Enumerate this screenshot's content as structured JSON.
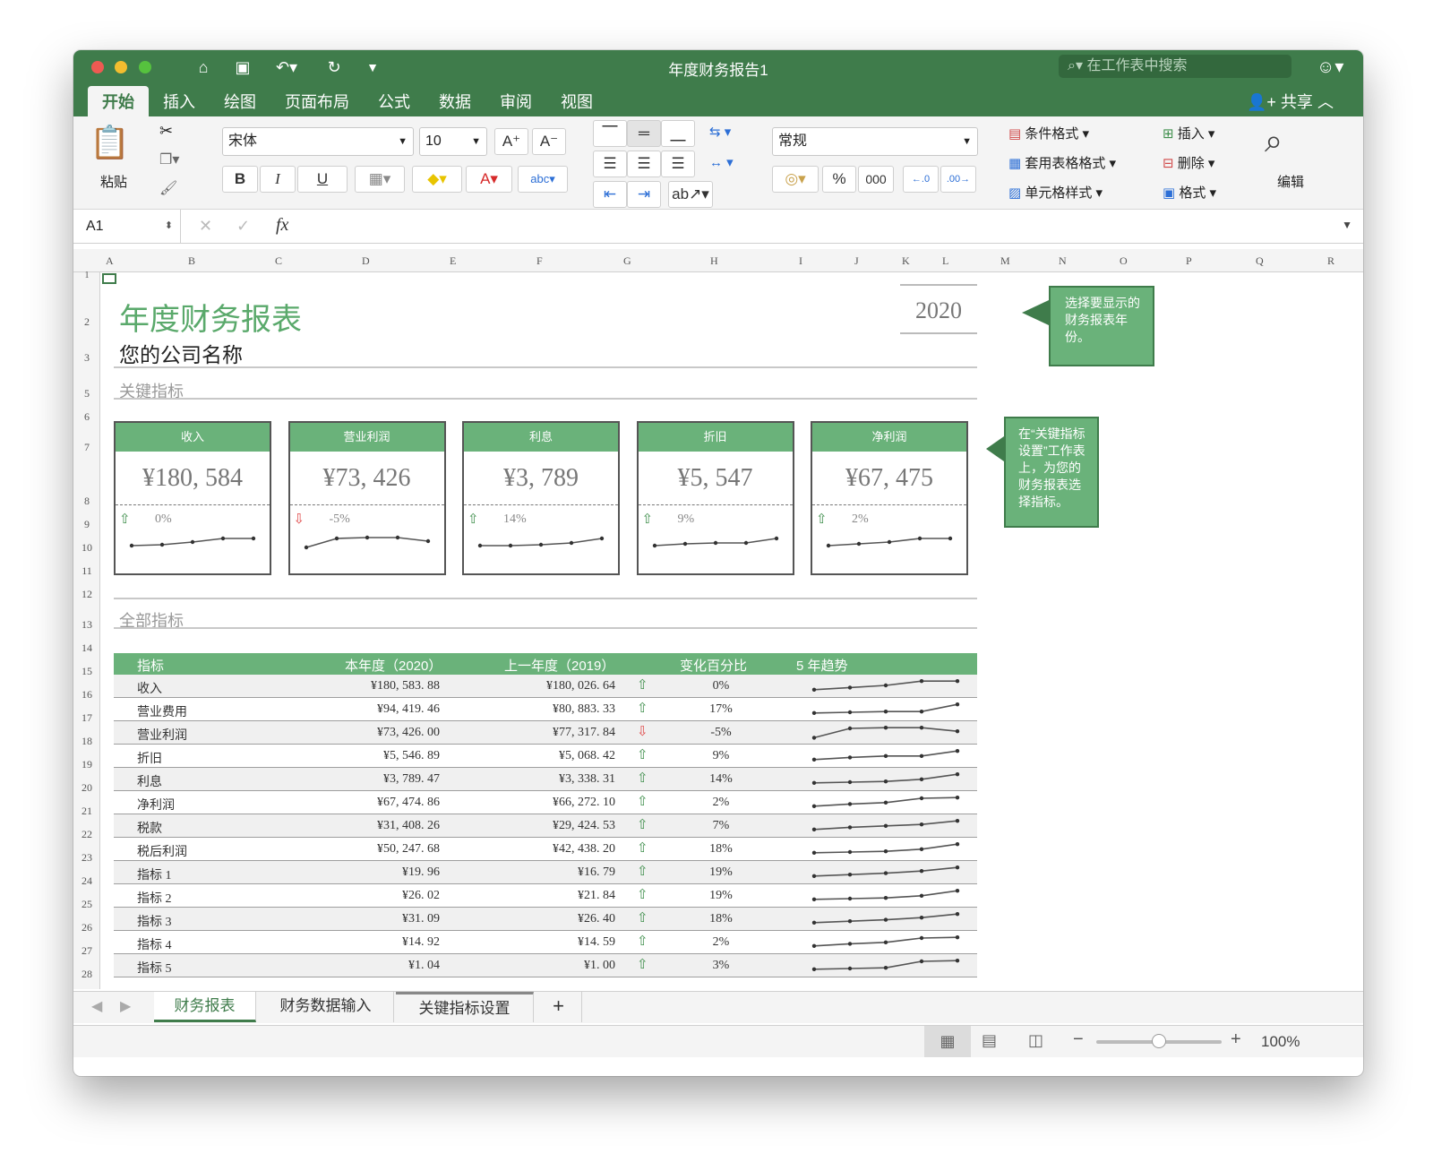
{
  "window": {
    "title": "年度财务报告1",
    "search_placeholder": "在工作表中搜索",
    "share": "共享",
    "tabs": [
      "开始",
      "插入",
      "绘图",
      "页面布局",
      "公式",
      "数据",
      "审阅",
      "视图"
    ],
    "active_tab": 0
  },
  "ribbon": {
    "paste": "粘贴",
    "font_name": "宋体",
    "font_size": "10",
    "number_format": "常规",
    "conditional_format": "条件格式",
    "table_format": "套用表格格式",
    "cell_styles": "单元格样式",
    "insert": "插入",
    "delete": "删除",
    "format": "格式",
    "edit": "编辑",
    "bold": "B",
    "italic": "I",
    "underline": "U",
    "percent": "%",
    "thousands": "000"
  },
  "formula_bar": {
    "cell_ref": "A1",
    "fx": "fx",
    "content": ""
  },
  "columns": [
    "A",
    "B",
    "C",
    "D",
    "E",
    "F",
    "G",
    "H",
    "I",
    "J",
    "K",
    "L",
    "M",
    "N",
    "O",
    "P",
    "Q",
    "R"
  ],
  "rows": [
    "1",
    "2",
    "3",
    "5",
    "6",
    "7",
    "8",
    "9",
    "10",
    "11",
    "12",
    "13",
    "14",
    "15",
    "16",
    "17",
    "18",
    "19",
    "20",
    "21",
    "22",
    "23",
    "24",
    "25",
    "26",
    "27",
    "28"
  ],
  "report": {
    "title": "年度财务报表",
    "company": "您的公司名称",
    "year": "2020",
    "key_metrics_heading": "关键指标",
    "all_metrics_heading": "全部指标",
    "callout_year": "选择要显示的财务报表年份。",
    "callout_metrics": "在“关键指标设置”工作表上，为您的财务报表选择指标。"
  },
  "kpis": [
    {
      "label": "收入",
      "value": "¥180, 584",
      "change": "0%",
      "direction": "up",
      "trend": [
        0.3,
        0.35,
        0.5,
        0.7,
        0.7
      ]
    },
    {
      "label": "营业利润",
      "value": "¥73, 426",
      "change": "-5%",
      "direction": "down",
      "trend": [
        0.2,
        0.7,
        0.75,
        0.75,
        0.55
      ]
    },
    {
      "label": "利息",
      "value": "¥3, 789",
      "change": "14%",
      "direction": "up",
      "trend": [
        0.3,
        0.3,
        0.35,
        0.45,
        0.7
      ]
    },
    {
      "label": "折旧",
      "value": "¥5, 547",
      "change": "9%",
      "direction": "up",
      "trend": [
        0.3,
        0.4,
        0.45,
        0.45,
        0.7
      ]
    },
    {
      "label": "净利润",
      "value": "¥67, 475",
      "change": "2%",
      "direction": "up",
      "trend": [
        0.3,
        0.4,
        0.5,
        0.7,
        0.7
      ]
    }
  ],
  "table": {
    "headers": [
      "指标",
      "本年度（2020）",
      "上一年度（2019）",
      "变化百分比",
      "5 年趋势"
    ],
    "rows": [
      {
        "name": "收入",
        "current": "¥180, 583. 88",
        "previous": "¥180, 026. 64",
        "direction": "up",
        "pct": "0%",
        "trend": [
          0.2,
          0.35,
          0.5,
          0.8,
          0.8
        ]
      },
      {
        "name": "营业费用",
        "current": "¥94, 419. 46",
        "previous": "¥80, 883. 33",
        "direction": "up",
        "pct": "17%",
        "trend": [
          0.2,
          0.25,
          0.3,
          0.3,
          0.8
        ]
      },
      {
        "name": "营业利润",
        "current": "¥73, 426. 00",
        "previous": "¥77, 317. 84",
        "direction": "down",
        "pct": "-5%",
        "trend": [
          0.1,
          0.75,
          0.8,
          0.8,
          0.55
        ]
      },
      {
        "name": "折旧",
        "current": "¥5, 546. 89",
        "previous": "¥5, 068. 42",
        "direction": "up",
        "pct": "9%",
        "trend": [
          0.2,
          0.35,
          0.45,
          0.45,
          0.8
        ]
      },
      {
        "name": "利息",
        "current": "¥3, 789. 47",
        "previous": "¥3, 338. 31",
        "direction": "up",
        "pct": "14%",
        "trend": [
          0.2,
          0.25,
          0.3,
          0.45,
          0.8
        ]
      },
      {
        "name": "净利润",
        "current": "¥67, 474. 86",
        "previous": "¥66, 272. 10",
        "direction": "up",
        "pct": "2%",
        "trend": [
          0.2,
          0.35,
          0.45,
          0.75,
          0.8
        ]
      },
      {
        "name": "税款",
        "current": "¥31, 408. 26",
        "previous": "¥29, 424. 53",
        "direction": "up",
        "pct": "7%",
        "trend": [
          0.2,
          0.35,
          0.45,
          0.55,
          0.8
        ]
      },
      {
        "name": "税后利润",
        "current": "¥50, 247. 68",
        "previous": "¥42, 438. 20",
        "direction": "up",
        "pct": "18%",
        "trend": [
          0.2,
          0.25,
          0.3,
          0.45,
          0.8
        ]
      },
      {
        "name": "指标 1",
        "current": "¥19. 96",
        "previous": "¥16. 79",
        "direction": "up",
        "pct": "19%",
        "trend": [
          0.2,
          0.3,
          0.4,
          0.55,
          0.8
        ]
      },
      {
        "name": "指标 2",
        "current": "¥26. 02",
        "previous": "¥21. 84",
        "direction": "up",
        "pct": "19%",
        "trend": [
          0.2,
          0.25,
          0.3,
          0.45,
          0.8
        ]
      },
      {
        "name": "指标 3",
        "current": "¥31. 09",
        "previous": "¥26. 40",
        "direction": "up",
        "pct": "18%",
        "trend": [
          0.2,
          0.3,
          0.4,
          0.55,
          0.8
        ]
      },
      {
        "name": "指标 4",
        "current": "¥14. 92",
        "previous": "¥14. 59",
        "direction": "up",
        "pct": "2%",
        "trend": [
          0.2,
          0.35,
          0.45,
          0.75,
          0.8
        ]
      },
      {
        "name": "指标 5",
        "current": "¥1. 04",
        "previous": "¥1. 00",
        "direction": "up",
        "pct": "3%",
        "trend": [
          0.2,
          0.25,
          0.3,
          0.75,
          0.8
        ]
      }
    ]
  },
  "sheet_tabs": [
    "财务报表",
    "财务数据输入",
    "关键指标设置"
  ],
  "active_sheet": 0,
  "zoom": "100%",
  "colors": {
    "accent": "#3f7c4b",
    "green_fill": "#6ab27a",
    "up": "#3f8f4c",
    "down": "#e04848"
  }
}
